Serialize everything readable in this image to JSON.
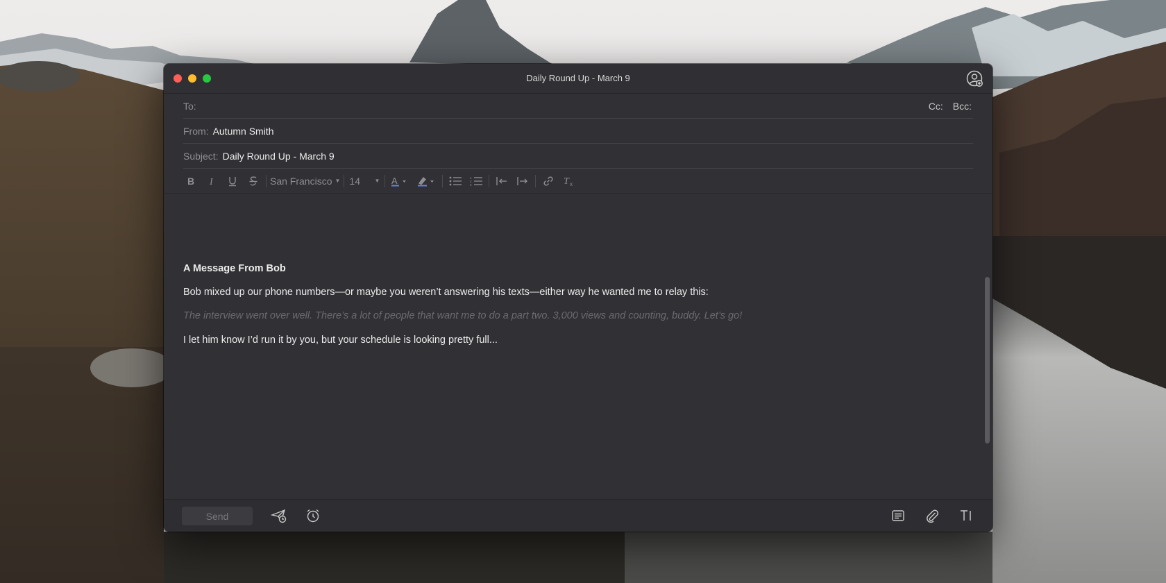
{
  "window": {
    "title": "Daily Round Up - March 9",
    "contact_icon": "add-contact-icon"
  },
  "fields": {
    "to_label": "To:",
    "to_value": "",
    "cc_label": "Cc:",
    "bcc_label": "Bcc:",
    "from_label": "From:",
    "from_value": "Autumn Smith",
    "subject_label": "Subject:",
    "subject_value": "Daily Round Up - March 9"
  },
  "toolbar": {
    "font_family": "San Francisco",
    "font_size": "14",
    "buttons": [
      "bold-icon",
      "italic-icon",
      "underline-icon",
      "strikethrough-icon",
      "text-color-icon",
      "highlight-icon",
      "bulleted-list-icon",
      "numbered-list-icon",
      "outdent-icon",
      "indent-icon",
      "link-icon",
      "clear-format-icon"
    ]
  },
  "message": {
    "heading": "A Message From Bob",
    "line1": "Bob mixed up our phone numbers—or maybe you weren’t answering his texts—either way he wanted me to relay this:",
    "quote": "The interview went over well. There’s a lot of people that want me to do a part two. 3,000 views and counting, buddy. Let’s go!",
    "line2": "I let him know I’d run it by you, but your schedule is looking pretty full..."
  },
  "bottom": {
    "send_label": "Send",
    "icons": [
      "send-later-icon",
      "reminder-clock-icon",
      "template-icon",
      "attachment-icon",
      "text-format-icon"
    ]
  },
  "colors": {
    "window_bg": "#313135",
    "traffic_close": "#fe5f57",
    "traffic_min": "#febc2e",
    "traffic_max": "#28c840"
  }
}
